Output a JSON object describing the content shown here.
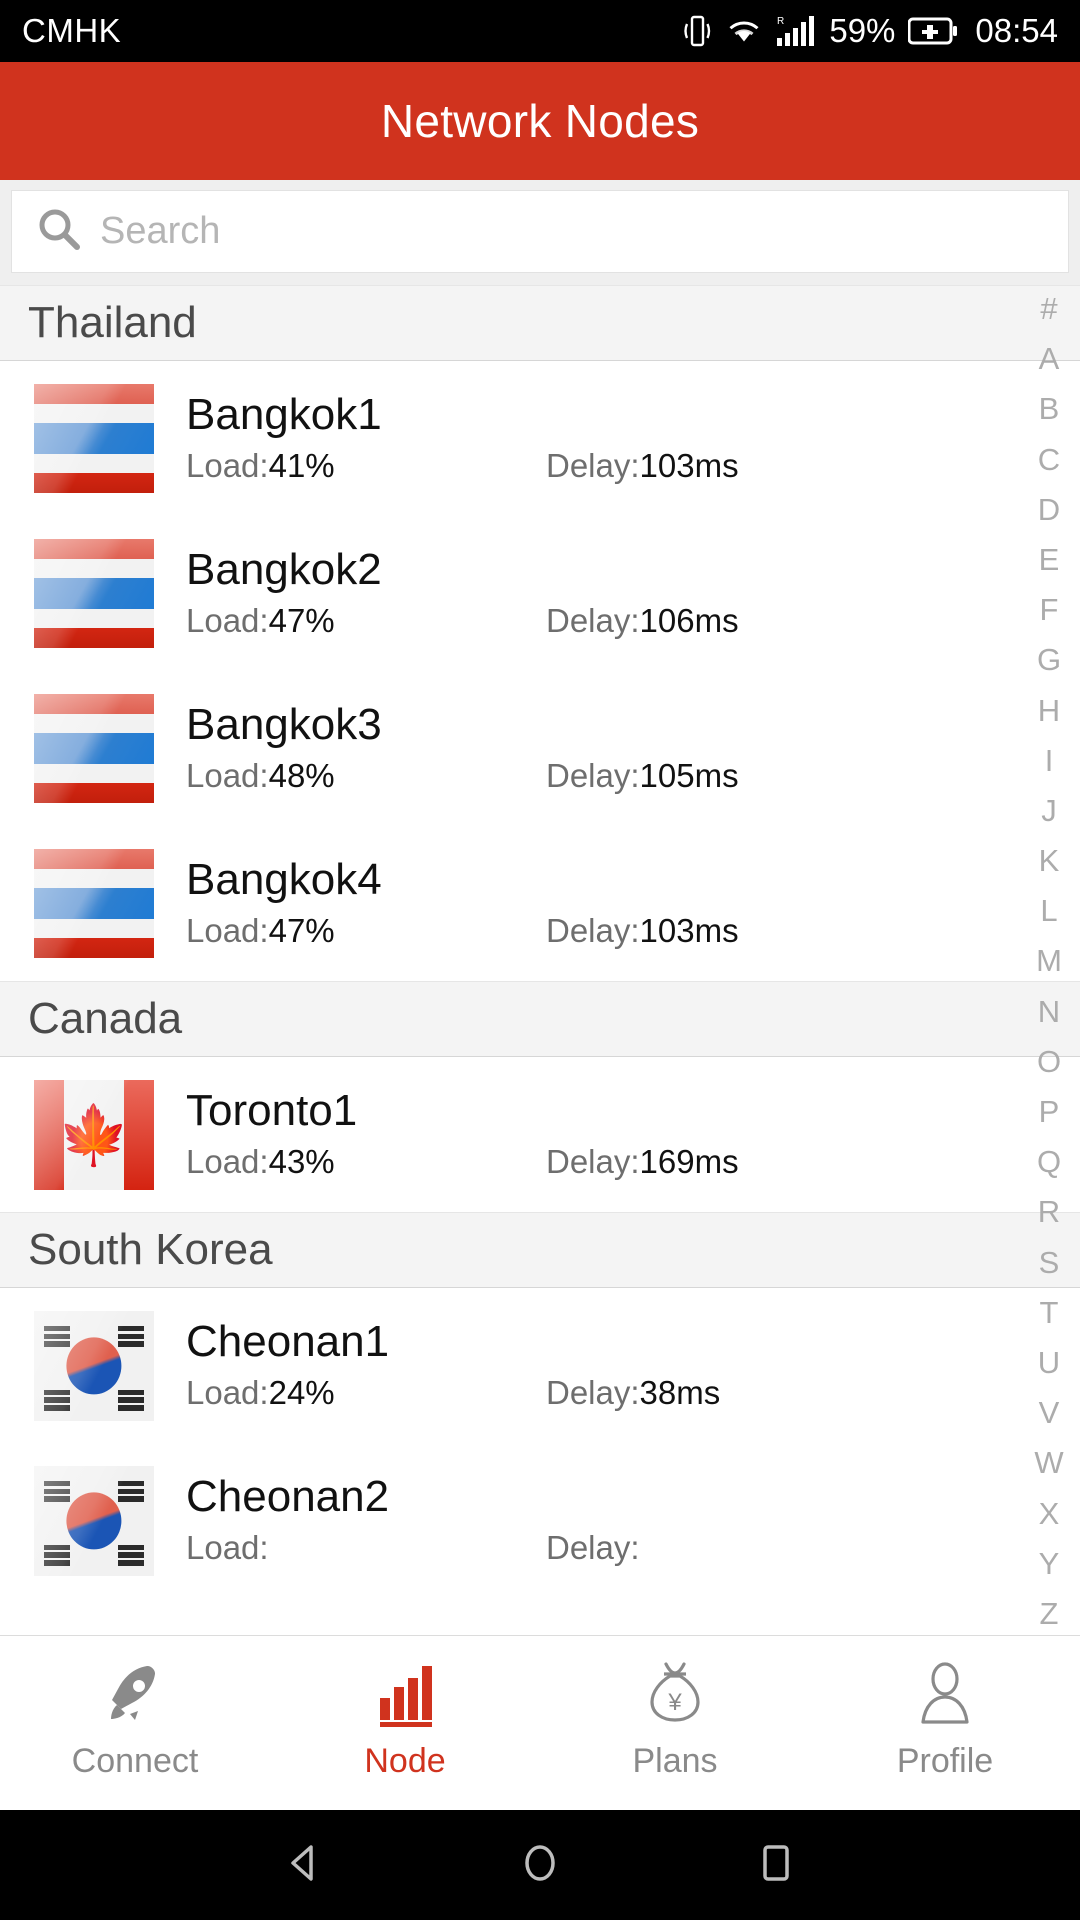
{
  "statusbar": {
    "carrier": "CMHK",
    "battery_percent": "59%",
    "clock": "08:54",
    "roaming_letter": "R",
    "icons": [
      "vibrate-icon",
      "wifi-icon",
      "cellular-signal-icon",
      "battery-charging-icon"
    ]
  },
  "appbar": {
    "title": "Network Nodes"
  },
  "search": {
    "placeholder": "Search",
    "value": "",
    "icon": "search-icon"
  },
  "alpha_index": [
    "#",
    "A",
    "B",
    "C",
    "D",
    "E",
    "F",
    "G",
    "H",
    "I",
    "J",
    "K",
    "L",
    "M",
    "N",
    "O",
    "P",
    "Q",
    "R",
    "S",
    "T",
    "U",
    "V",
    "W",
    "X",
    "Y",
    "Z"
  ],
  "labels": {
    "load_prefix": "Load:",
    "delay_prefix": "Delay:"
  },
  "sections": [
    {
      "country": "Thailand",
      "flag": "flag-th",
      "nodes": [
        {
          "name": "Bangkok1",
          "load": "41%",
          "delay": "103ms"
        },
        {
          "name": "Bangkok2",
          "load": "47%",
          "delay": "106ms"
        },
        {
          "name": "Bangkok3",
          "load": "48%",
          "delay": "105ms"
        },
        {
          "name": "Bangkok4",
          "load": "47%",
          "delay": "103ms"
        }
      ]
    },
    {
      "country": "Canada",
      "flag": "flag-ca",
      "nodes": [
        {
          "name": "Toronto1",
          "load": "43%",
          "delay": "169ms"
        }
      ]
    },
    {
      "country": "South Korea",
      "flag": "flag-kr",
      "nodes": [
        {
          "name": "Cheonan1",
          "load": "24%",
          "delay": "38ms"
        },
        {
          "name": "Cheonan2",
          "load": "",
          "delay": ""
        }
      ]
    }
  ],
  "tabbar": {
    "active": "Node",
    "active_color": "#D0331E",
    "items": [
      {
        "label": "Connect",
        "icon": "rocket-icon"
      },
      {
        "label": "Node",
        "icon": "bar-chart-icon"
      },
      {
        "label": "Plans",
        "icon": "money-bag-icon"
      },
      {
        "label": "Profile",
        "icon": "person-icon"
      }
    ]
  },
  "navbar": {
    "items": [
      "back-triangle-icon",
      "home-circle-icon",
      "recents-square-icon"
    ]
  }
}
